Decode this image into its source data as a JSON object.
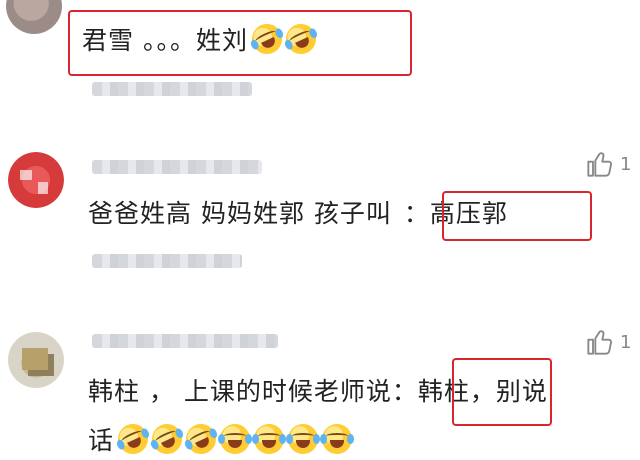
{
  "comments": [
    {
      "text": "君雪 。。。姓刘",
      "like_count": ""
    },
    {
      "text_before": "爸爸姓高 妈妈姓郭 孩子叫",
      "text_highlight": "：高压郭",
      "like_count": "1"
    },
    {
      "line1_before": "韩柱 ， 上课的时候老师说：",
      "line1_highlight": "韩柱，",
      "line1_after": "别说",
      "line2": "话",
      "like_count": "1"
    }
  ],
  "icons": {
    "like": "thumb-up-icon",
    "emoji": "laughing-tears-emoji"
  },
  "colors": {
    "highlight_border": "#d9252c",
    "text": "#222222",
    "like": "#888888"
  }
}
